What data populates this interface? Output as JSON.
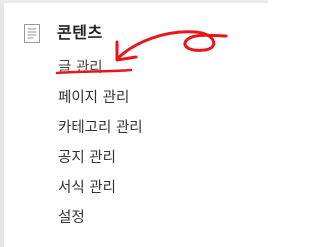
{
  "section": {
    "title": "콘텐츠",
    "icon": "document-icon"
  },
  "menu": {
    "items": [
      {
        "label": "글 관리",
        "active": true
      },
      {
        "label": "페이지 관리",
        "active": false
      },
      {
        "label": "카테고리 관리",
        "active": false
      },
      {
        "label": "공지 관리",
        "active": false
      },
      {
        "label": "서식 관리",
        "active": false
      },
      {
        "label": "설정",
        "active": false
      }
    ]
  },
  "annotation": {
    "color": "#e8161a",
    "type": "hand-drawn-arrow-and-underline"
  }
}
